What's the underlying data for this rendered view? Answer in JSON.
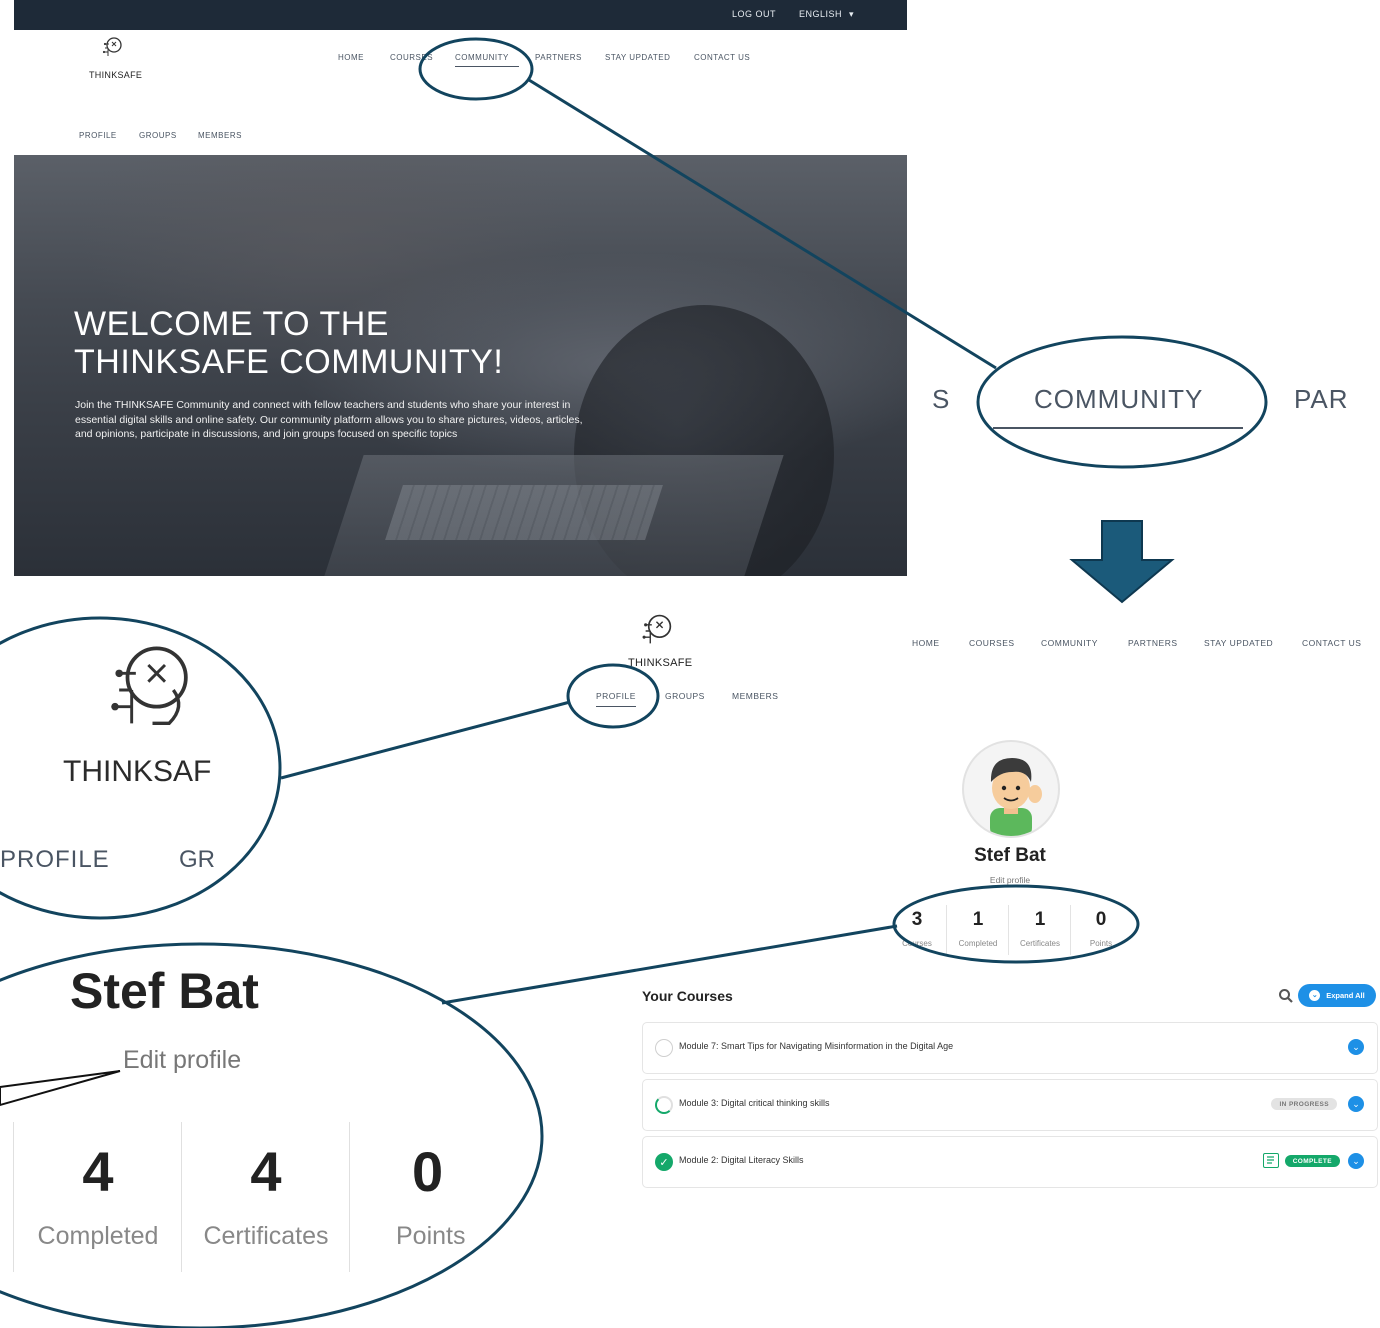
{
  "top_screenshot": {
    "topbar": {
      "logout": "LOG OUT",
      "language": "ENGLISH",
      "language_caret": "▾"
    },
    "logo": {
      "text": "THINKSAFE",
      "icon": "brain-circuit-icon"
    },
    "nav": [
      "HOME",
      "COURSES",
      "COMMUNITY",
      "PARTNERS",
      "STAY UPDATED",
      "CONTACT US"
    ],
    "subnav": [
      "PROFILE",
      "GROUPS",
      "MEMBERS"
    ],
    "hero": {
      "title_line1": "WELCOME TO THE",
      "title_line2": "THINKSAFE COMMUNITY!",
      "text": "Join the THINKSAFE Community and connect with fellow teachers and students who share your interest in essential digital skills and online safety. Our community platform allows you to share pictures, videos, articles, and opinions, participate in discussions, and join groups focused on specific topics"
    }
  },
  "zoom_community": {
    "left": "S",
    "label": "COMMUNITY",
    "right": "PAR"
  },
  "bottom_screenshot": {
    "logo": {
      "text": "THINKSAFE",
      "icon": "brain-circuit-icon"
    },
    "nav": [
      "HOME",
      "COURSES",
      "COMMUNITY",
      "PARTNERS",
      "STAY UPDATED",
      "CONTACT US"
    ],
    "subnav": [
      "PROFILE",
      "GROUPS",
      "MEMBERS"
    ],
    "profile": {
      "name": "Stef Bat",
      "edit": "Edit profile",
      "stats": [
        {
          "value": "3",
          "label": "Courses"
        },
        {
          "value": "1",
          "label": "Completed"
        },
        {
          "value": "1",
          "label": "Certificates"
        },
        {
          "value": "0",
          "label": "Points"
        }
      ]
    },
    "courses": {
      "title": "Your Courses",
      "expand_all": "Expand All",
      "items": [
        {
          "title": "Module 7: Smart Tips for Navigating Misinformation in the Digital Age",
          "status": "not-started",
          "badge": ""
        },
        {
          "title": "Module 3: Digital critical thinking skills",
          "status": "in-progress",
          "badge": "IN PROGRESS"
        },
        {
          "title": "Module 2: Digital Literacy Skills",
          "status": "complete",
          "badge": "COMPLETE"
        }
      ]
    }
  },
  "zoom_logo": {
    "text": "THINKSAF",
    "profile": "PROFILE",
    "groups": "GR"
  },
  "zoom_profile": {
    "name": "Stef Bat",
    "edit": "Edit profile",
    "stats": [
      {
        "value": "4",
        "label": "Completed"
      },
      {
        "value": "4",
        "label": "Certificates"
      },
      {
        "value": "0",
        "label": "Points"
      }
    ]
  },
  "colors": {
    "callout_stroke": "#12445e",
    "arrow_fill": "#1b5a7a",
    "accent_blue": "#1e90e6",
    "complete_green": "#14a86a",
    "topbar": "#1e2a38"
  }
}
